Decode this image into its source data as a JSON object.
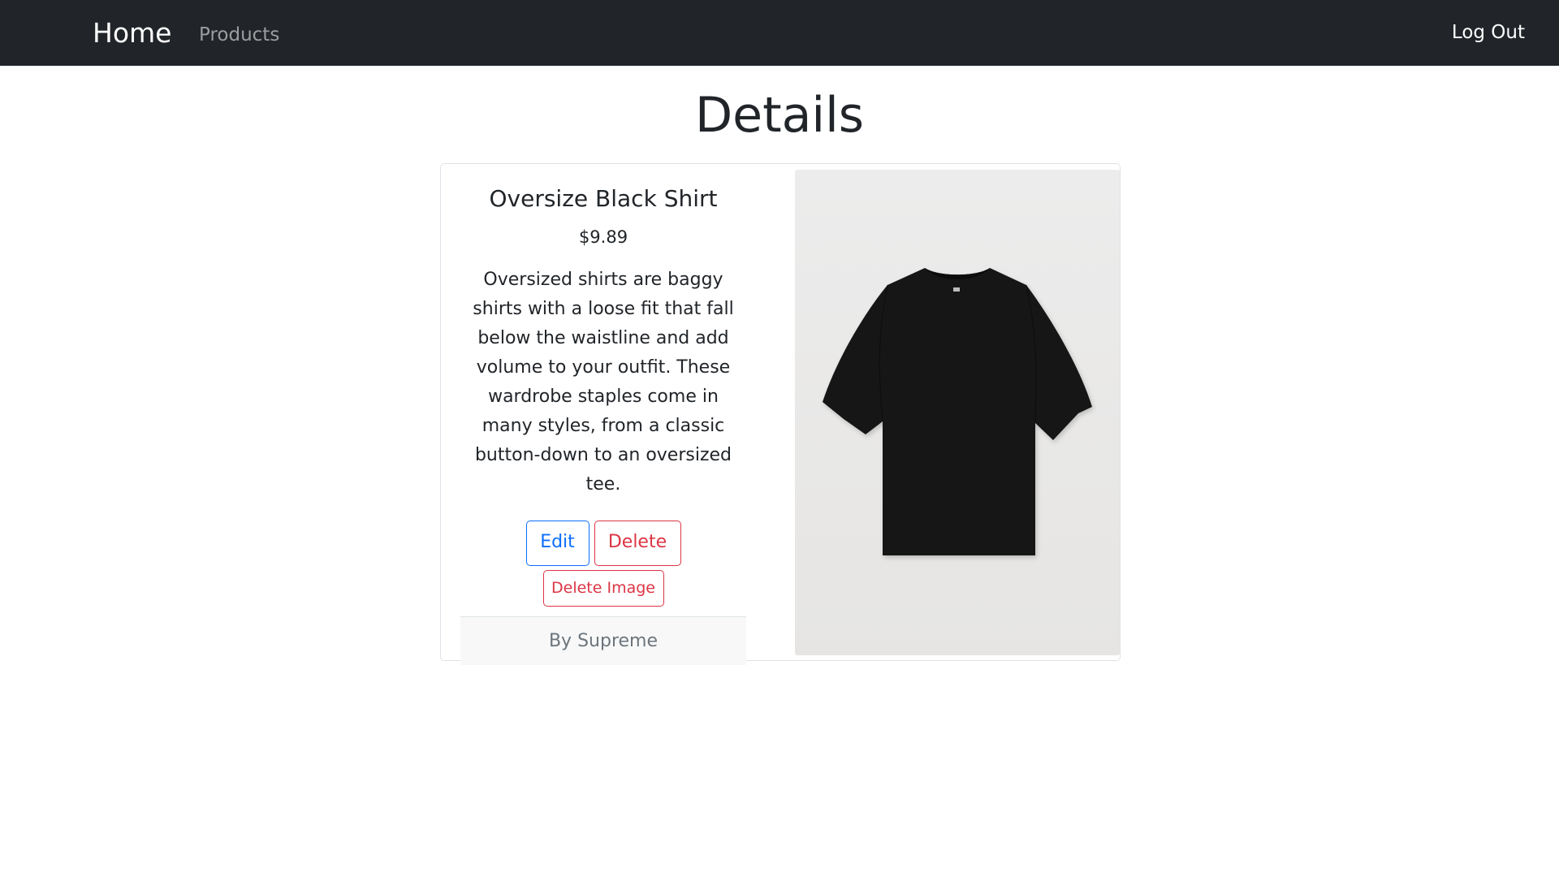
{
  "nav": {
    "brand": "Home",
    "products": "Products",
    "logout": "Log Out"
  },
  "page": {
    "title": "Details"
  },
  "product": {
    "name": "Oversize Black Shirt",
    "price": "$9.89",
    "description": "Oversized shirts are baggy shirts with a loose fit that fall below the waistline and add volume to your outfit. These wardrobe staples come in many styles, from a classic button-down to an oversized tee.",
    "brand_line": "By Supreme",
    "image_alt": "black oversized t-shirt"
  },
  "actions": {
    "edit": "Edit",
    "delete": "Delete",
    "delete_image": "Delete Image"
  },
  "colors": {
    "navbar": "#212529",
    "primary": "#0d6efd",
    "danger": "#dc3545",
    "muted": "#6c757d"
  }
}
